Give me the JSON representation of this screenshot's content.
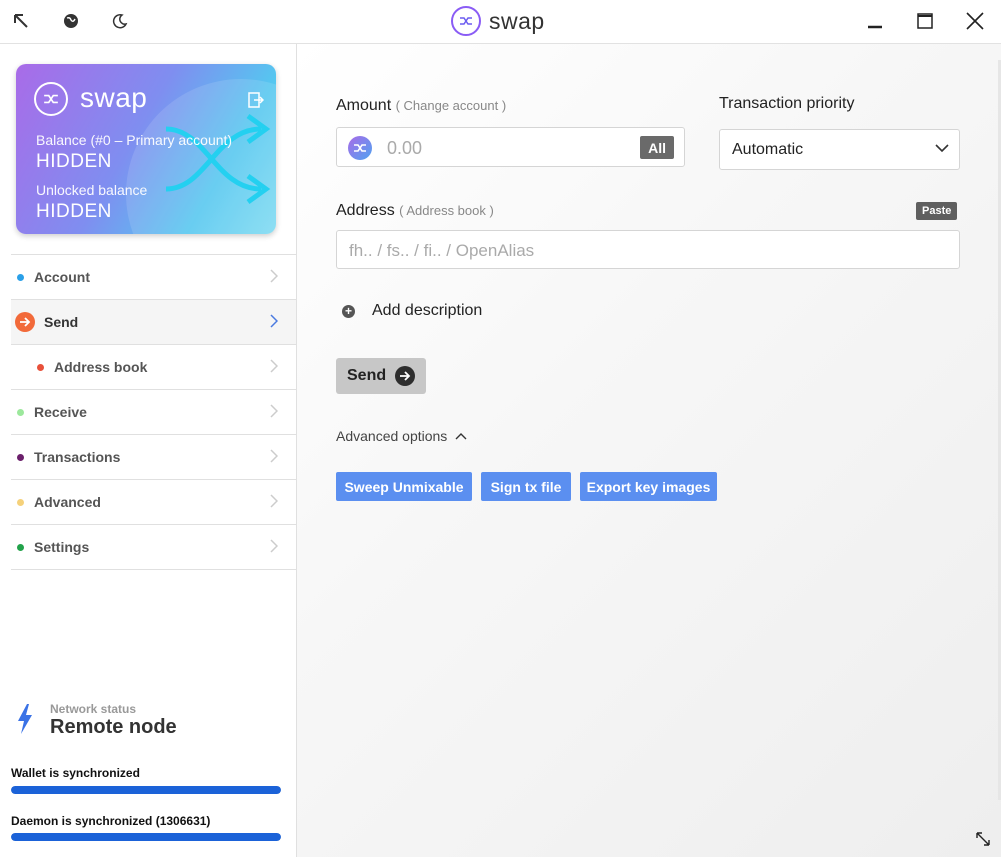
{
  "titlebar": {
    "app_name": "swap",
    "icons": [
      "back-arrow-icon",
      "globe-icon",
      "moon-icon",
      "minimize-icon",
      "maximize-icon",
      "close-icon"
    ]
  },
  "card": {
    "brand": "swap",
    "balance_label": "Balance (#0 – Primary account)",
    "balance_value": "HIDDEN",
    "unlocked_label": "Unlocked balance",
    "unlocked_value": "HIDDEN"
  },
  "sidebar": {
    "items": [
      {
        "label": "Account",
        "dot": "#2aa0e8"
      },
      {
        "label": "Send",
        "dot": "#f26a3a"
      },
      {
        "label": "Address book",
        "dot": "#e8503a"
      },
      {
        "label": "Receive",
        "dot": "#9ce89c"
      },
      {
        "label": "Transactions",
        "dot": "#6b1f6b"
      },
      {
        "label": "Advanced",
        "dot": "#f5d17a"
      },
      {
        "label": "Settings",
        "dot": "#22a24a"
      }
    ],
    "network_status_label": "Network status",
    "network_status_value": "Remote node",
    "wallet_sync_label": "Wallet is synchronized",
    "wallet_sync_progress": 1.0,
    "daemon_sync_label": "Daemon is synchronized (1306631)",
    "daemon_sync_progress": 1.0
  },
  "form": {
    "amount_label": "Amount",
    "change_account_link": "( Change account )",
    "amount_placeholder": "0.00",
    "all_button": "All",
    "priority_label": "Transaction priority",
    "priority_value": "Automatic",
    "address_label": "Address",
    "address_book_link": "( Address book )",
    "paste_button": "Paste",
    "address_placeholder": "fh.. / fs.. / fi.. / OpenAlias",
    "add_description": "Add description",
    "send_button": "Send",
    "advanced_options": "Advanced options",
    "sweep_button": "Sweep Unmixable",
    "sign_button": "Sign tx file",
    "export_button": "Export key images"
  },
  "colors": {
    "accent_blue": "#5b8ff0",
    "sync_bar": "#1b62d8"
  }
}
